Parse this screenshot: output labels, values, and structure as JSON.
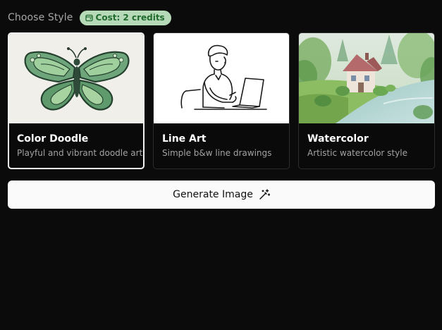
{
  "header": {
    "label": "Choose Style",
    "cost_badge": "Cost: 2 credits",
    "cost_icon": "coins-icon"
  },
  "styles": [
    {
      "title": "Color Doodle",
      "description": "Playful and vibrant doodle art",
      "thumbnail": "butterfly-doodle-image",
      "selected": true
    },
    {
      "title": "Line Art",
      "description": "Simple b&w line drawings",
      "thumbnail": "person-at-laptop-line-drawing",
      "selected": false
    },
    {
      "title": "Watercolor",
      "description": "Artistic watercolor style",
      "thumbnail": "watercolor-house-by-river",
      "selected": false
    }
  ],
  "generate": {
    "label": "Generate Image",
    "icon": "magic-wand-icon"
  },
  "colors": {
    "background": "#0b0b0b",
    "badge_bg": "#b6d9b8",
    "badge_text": "#206b2e",
    "button_bg": "#fafafa"
  }
}
